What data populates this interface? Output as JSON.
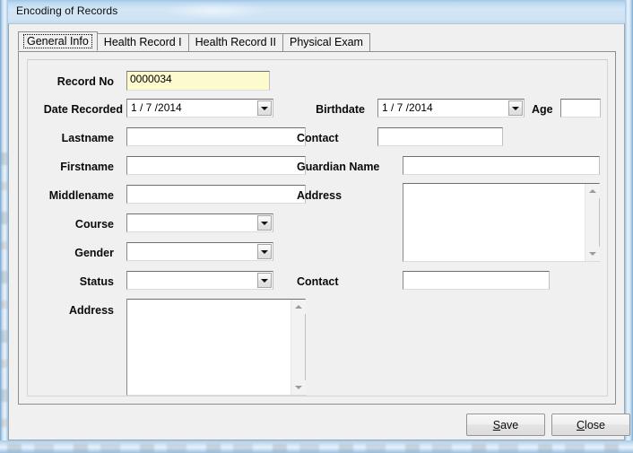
{
  "window": {
    "title": "Encoding of Records"
  },
  "tabs": [
    {
      "label": "General Info",
      "selected": true
    },
    {
      "label": "Health Record I",
      "selected": false
    },
    {
      "label": "Health Record II",
      "selected": false
    },
    {
      "label": "Physical Exam",
      "selected": false
    }
  ],
  "form": {
    "record_no": {
      "label": "Record No",
      "value": "0000034",
      "placeholder": ""
    },
    "date_recorded": {
      "label": "Date Recorded",
      "value": "1 / 7 /2014"
    },
    "lastname": {
      "label": "Lastname",
      "value": "",
      "placeholder": ""
    },
    "firstname": {
      "label": "Firstname",
      "value": "",
      "placeholder": ""
    },
    "middlename": {
      "label": "Middlename",
      "value": "",
      "placeholder": ""
    },
    "course": {
      "label": "Course",
      "value": ""
    },
    "gender": {
      "label": "Gender",
      "value": ""
    },
    "status": {
      "label": "Status",
      "value": ""
    },
    "address_left": {
      "label": "Address",
      "value": "",
      "placeholder": ""
    },
    "birthdate": {
      "label": "Birthdate",
      "value": "1 / 7 /2014"
    },
    "age": {
      "label": "Age",
      "value": "",
      "placeholder": ""
    },
    "contact_top": {
      "label": "Contact",
      "value": "",
      "placeholder": ""
    },
    "guardian_name": {
      "label": "Guardian Name",
      "value": "",
      "placeholder": ""
    },
    "address_right": {
      "label": "Address",
      "value": "",
      "placeholder": ""
    },
    "contact_bottom": {
      "label": "Contact",
      "value": "",
      "placeholder": ""
    }
  },
  "footer": {
    "save": {
      "prefix": "",
      "mnemonic": "S",
      "suffix": "ave"
    },
    "close": {
      "prefix": "",
      "mnemonic": "C",
      "suffix": "lose"
    }
  },
  "colors": {
    "highlight_field": "#fdfbcd",
    "client_background": "#f0f0f0",
    "glass_frame": "#bcd9ef"
  }
}
